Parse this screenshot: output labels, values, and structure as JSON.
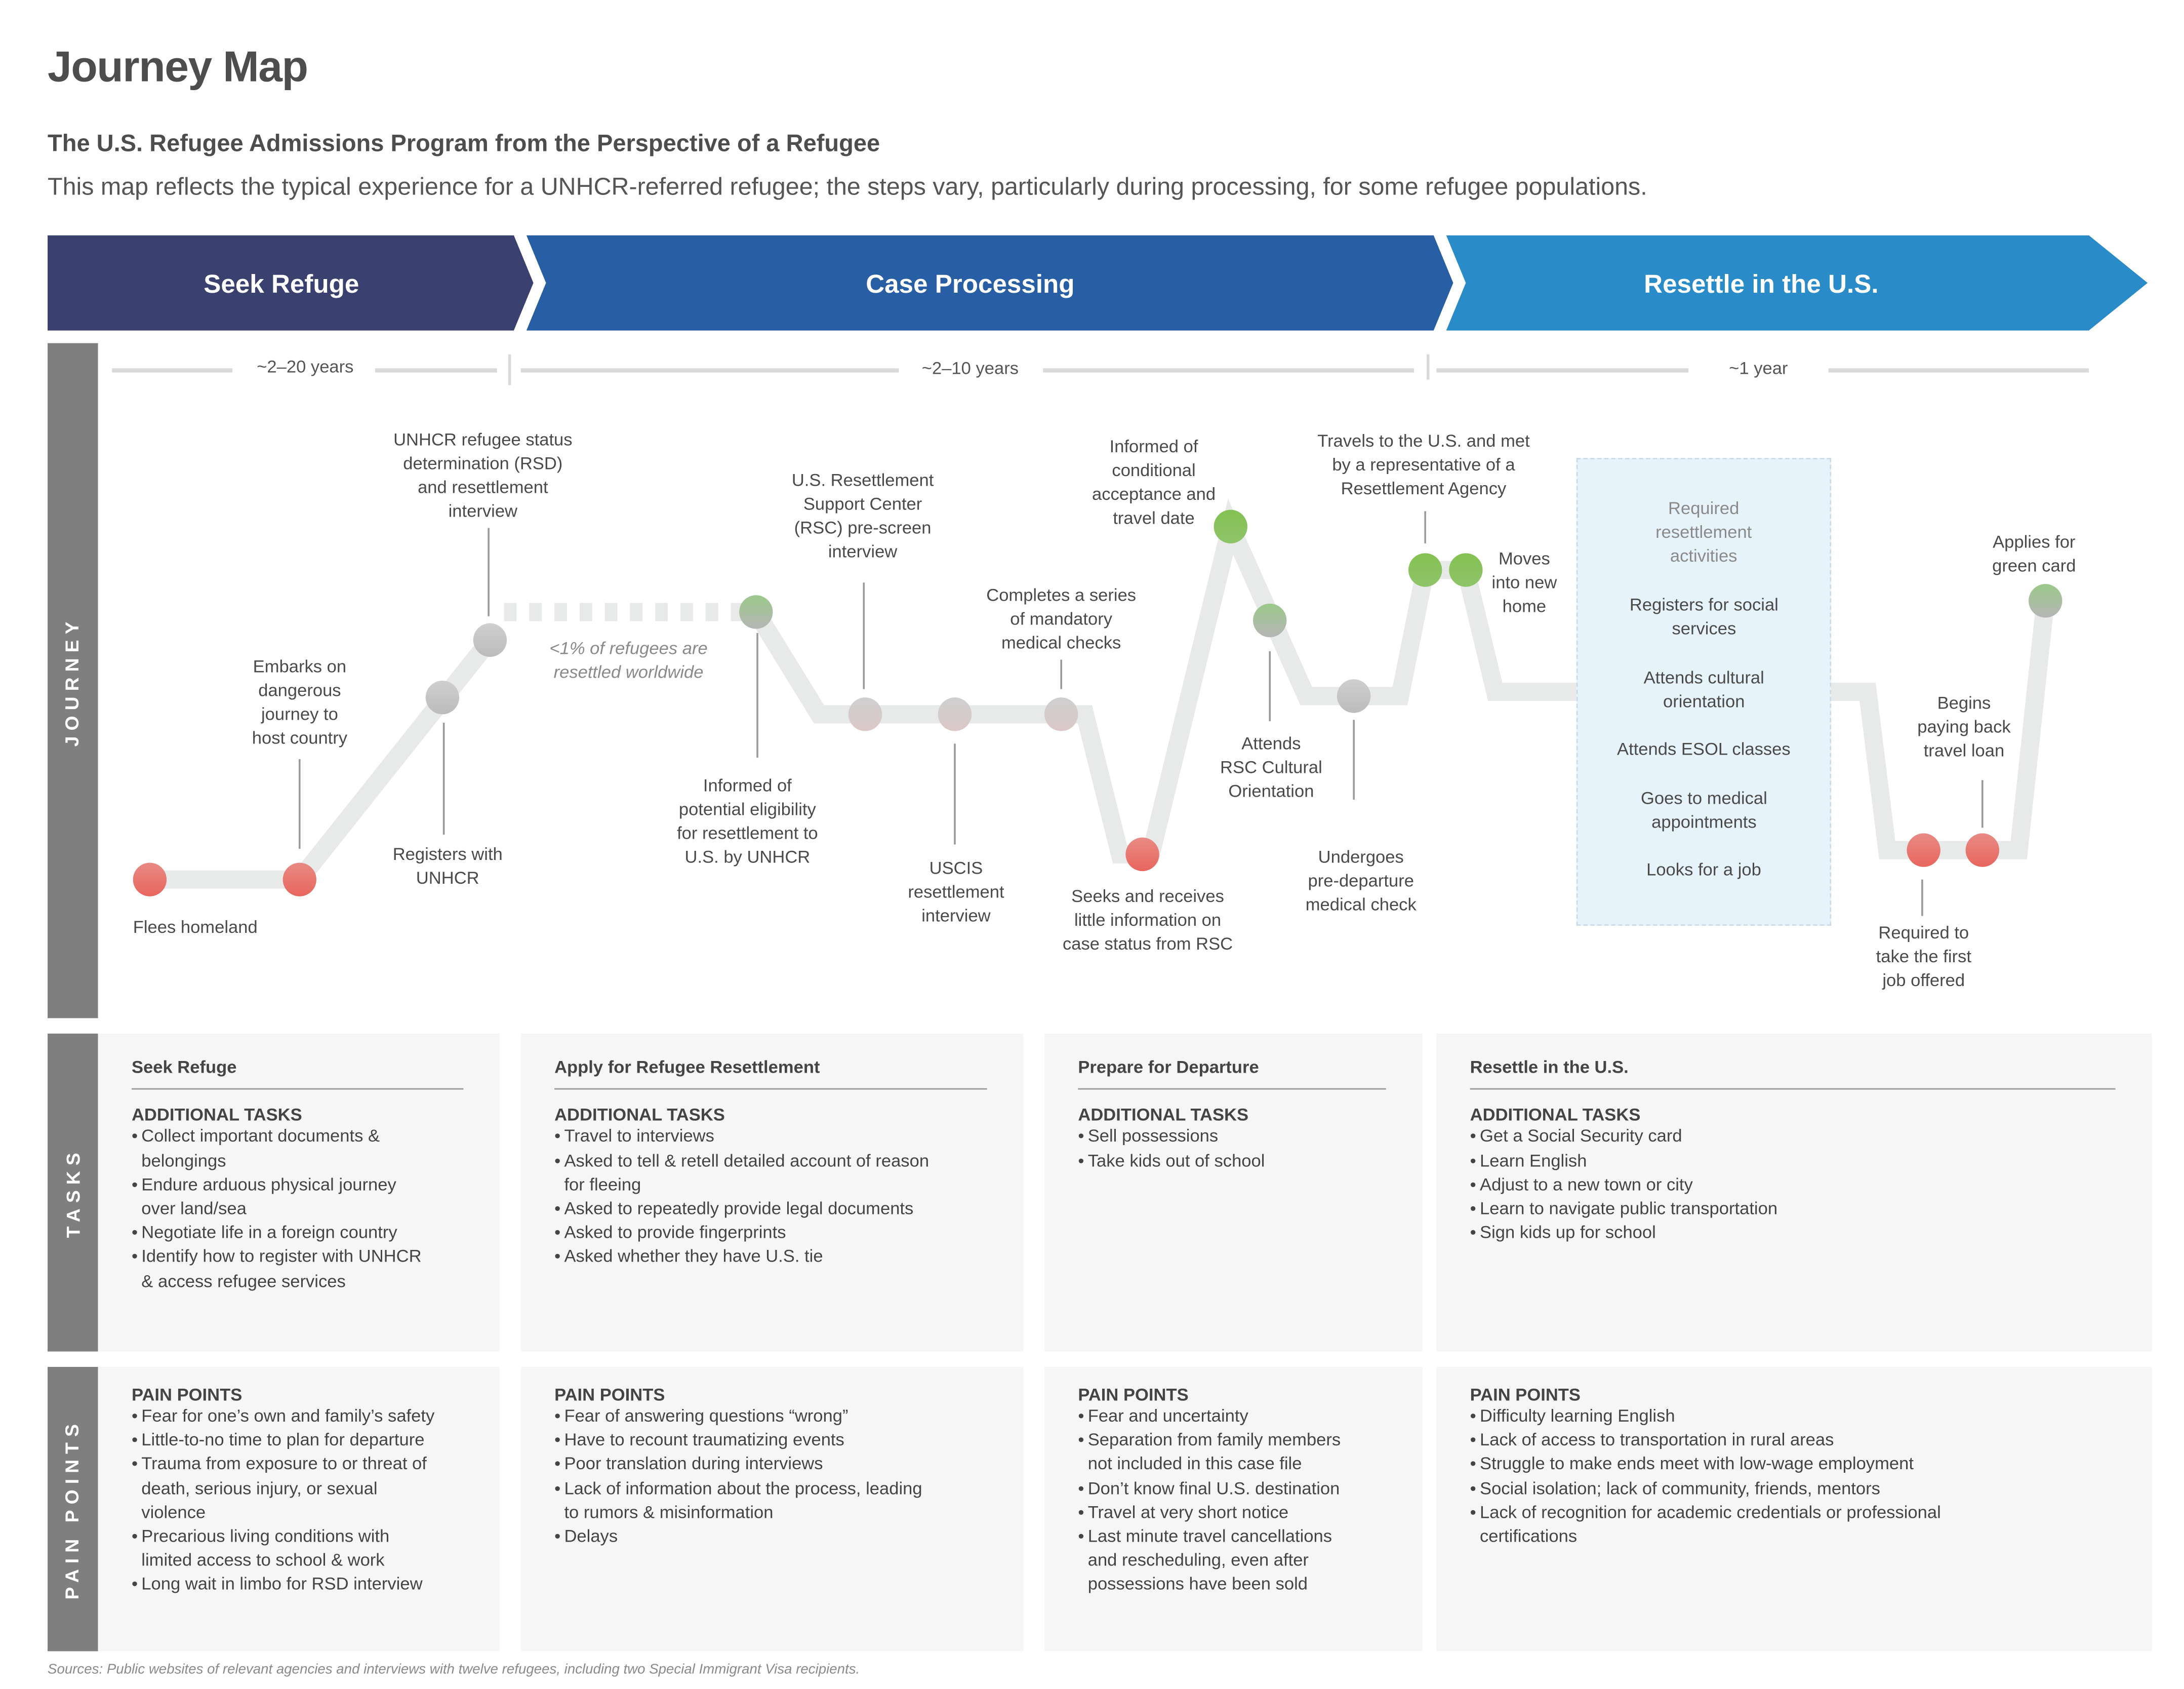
{
  "header": {
    "title": "Journey Map",
    "subtitle": "The U.S. Refugee Admissions Program from the Perspective of a Refugee",
    "description": "This map reflects the typical experience for a UNHCR-referred refugee; the steps vary, particularly during processing, for some refugee populations."
  },
  "phases": [
    {
      "label": "Seek Refuge",
      "color": "#3a416f"
    },
    {
      "label": "Case Processing",
      "color": "#285ea3"
    },
    {
      "label": "Resettle in the U.S.",
      "color": "#2a8bc9"
    }
  ],
  "row_labels": {
    "journey": "JOURNEY",
    "tasks": "TASKS",
    "pain_points": "PAIN POINTS"
  },
  "durations": [
    "~2–20 years",
    "~2–10 years",
    "~1 year"
  ],
  "journey": {
    "annotation": [
      "<1% of refugees are",
      "resettled worldwide"
    ],
    "status_colors": {
      "negative": "#e8706a",
      "neutral": "#c8c8c8",
      "positive": "#86c15a",
      "path": "#e8e9e9"
    },
    "steps": [
      {
        "id": "flees",
        "lines": [
          "Flees homeland"
        ],
        "status": "negative"
      },
      {
        "id": "embarks",
        "lines": [
          "Embarks on",
          "dangerous",
          "journey to",
          "host country"
        ],
        "status": "negative"
      },
      {
        "id": "registers",
        "lines": [
          "Registers with",
          "UNHCR"
        ],
        "status": "neutral"
      },
      {
        "id": "rsd",
        "lines": [
          "UNHCR refugee status",
          "determination (RSD)",
          "and resettlement",
          "interview"
        ],
        "status": "neutral"
      },
      {
        "id": "informed-eligibility",
        "lines": [
          "Informed of",
          "potential eligibility",
          "for resettlement to",
          "U.S. by UNHCR"
        ],
        "status": "positive-neutral"
      },
      {
        "id": "rsc-prescreen",
        "lines": [
          "U.S. Resettlement",
          "Support Center",
          "(RSC) pre-screen",
          "interview"
        ],
        "status": "neutral-negative"
      },
      {
        "id": "uscis",
        "lines": [
          "USCIS",
          "resettlement",
          "interview"
        ],
        "status": "neutral-negative"
      },
      {
        "id": "medical",
        "lines": [
          "Completes a series",
          "of mandatory",
          "medical checks"
        ],
        "status": "neutral-negative"
      },
      {
        "id": "seeks-info",
        "lines": [
          "Seeks and receives",
          "little information on",
          "case status from RSC"
        ],
        "status": "negative"
      },
      {
        "id": "conditional",
        "lines": [
          "Informed of",
          "conditional",
          "acceptance and",
          "travel date"
        ],
        "status": "positive"
      },
      {
        "id": "cultural-orientation",
        "lines": [
          "Attends",
          "RSC Cultural",
          "Orientation"
        ],
        "status": "positive-neutral"
      },
      {
        "id": "pre-departure",
        "lines": [
          "Undergoes",
          "pre-departure",
          "medical check"
        ],
        "status": "neutral"
      },
      {
        "id": "travels",
        "lines": [
          "Travels to the U.S. and met",
          "by a representative of a",
          "Resettlement Agency"
        ],
        "status": "positive"
      },
      {
        "id": "moves",
        "lines": [
          "Moves",
          "into new",
          "home"
        ],
        "status": "positive"
      },
      {
        "id": "first-job",
        "lines": [
          "Required to",
          "take the first",
          "job offered"
        ],
        "status": "negative"
      },
      {
        "id": "travel-loan",
        "lines": [
          "Begins",
          "paying back",
          "travel loan"
        ],
        "status": "negative"
      },
      {
        "id": "green-card",
        "lines": [
          "Applies for",
          "green card"
        ],
        "status": "positive-neutral"
      }
    ],
    "required_activities": {
      "heading": [
        "Required",
        "resettlement",
        "activities"
      ],
      "items": [
        [
          "Registers for social",
          "services"
        ],
        [
          "Attends cultural",
          "orientation"
        ],
        [
          "Attends ESOL classes"
        ],
        [
          "Goes to medical",
          "appointments"
        ],
        [
          "Looks for a job"
        ]
      ]
    }
  },
  "tasks": [
    {
      "title": "Seek Refuge",
      "section": "ADDITIONAL TASKS",
      "items": [
        [
          "Collect important documents &",
          "belongings"
        ],
        [
          "Endure arduous physical journey",
          "over land/sea"
        ],
        [
          "Negotiate life in a foreign country"
        ],
        [
          "Identify how to register with UNHCR",
          "& access refugee services"
        ]
      ]
    },
    {
      "title": "Apply for Refugee Resettlement",
      "section": "ADDITIONAL TASKS",
      "items": [
        [
          "Travel to interviews"
        ],
        [
          "Asked to tell & retell detailed account of reason",
          "for fleeing"
        ],
        [
          "Asked to repeatedly provide legal documents"
        ],
        [
          "Asked to provide fingerprints"
        ],
        [
          "Asked whether they have U.S. tie"
        ]
      ]
    },
    {
      "title": "Prepare for Departure",
      "section": "ADDITIONAL TASKS",
      "items": [
        [
          "Sell possessions"
        ],
        [
          "Take kids out of school"
        ]
      ]
    },
    {
      "title": "Resettle in the U.S.",
      "section": "ADDITIONAL TASKS",
      "items": [
        [
          "Get a Social Security card"
        ],
        [
          "Learn English"
        ],
        [
          "Adjust to a new town or city"
        ],
        [
          "Learn to navigate public transportation"
        ],
        [
          "Sign kids up for school"
        ]
      ]
    }
  ],
  "pain_points": [
    {
      "section": "PAIN POINTS",
      "items": [
        [
          "Fear for one’s own and family’s safety"
        ],
        [
          "Little-to-no time to plan for departure"
        ],
        [
          "Trauma from exposure to or threat of",
          "death, serious injury, or sexual",
          "violence"
        ],
        [
          "Precarious living conditions with",
          "limited access to school & work"
        ],
        [
          "Long wait in limbo for RSD interview"
        ]
      ]
    },
    {
      "section": "PAIN POINTS",
      "items": [
        [
          "Fear of answering questions “wrong”"
        ],
        [
          "Have to recount traumatizing events"
        ],
        [
          "Poor translation during interviews"
        ],
        [
          "Lack of information about the process, leading",
          "to rumors & misinformation"
        ],
        [
          "Delays"
        ]
      ]
    },
    {
      "section": "PAIN POINTS",
      "items": [
        [
          "Fear and uncertainty"
        ],
        [
          "Separation from family members",
          "not included in this case file"
        ],
        [
          "Don’t know final U.S. destination"
        ],
        [
          "Travel at very short notice"
        ],
        [
          "Last minute travel cancellations",
          "and rescheduling, even after",
          "possessions have been sold"
        ]
      ]
    },
    {
      "section": "PAIN POINTS",
      "items": [
        [
          "Difficulty learning English"
        ],
        [
          "Lack of access to transportation in rural areas"
        ],
        [
          "Struggle to make ends meet with low-wage employment"
        ],
        [
          "Social isolation; lack of community, friends, mentors"
        ],
        [
          "Lack of recognition for academic credentials or professional",
          "certifications"
        ]
      ]
    }
  ],
  "footer": {
    "sources": "Sources: Public websites of relevant agencies and interviews with twelve refugees, including two Special Immigrant Visa recipients."
  }
}
